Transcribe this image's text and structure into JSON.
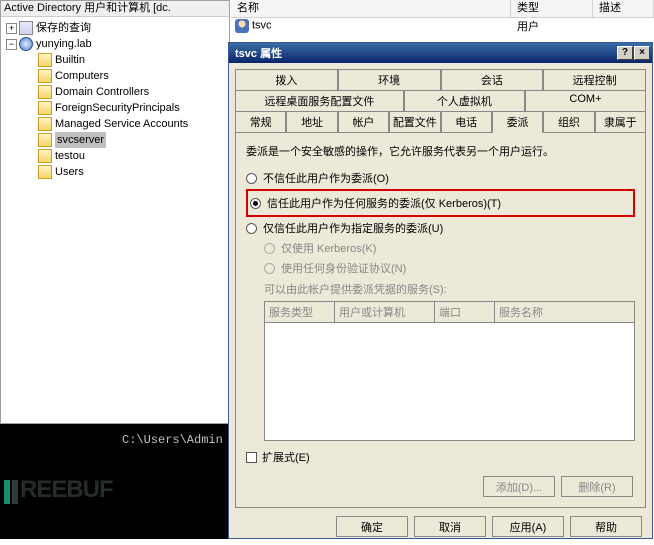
{
  "ad": {
    "title": "Active Directory 用户和计算机 [dc.",
    "saved_queries": "保存的查询",
    "domain": "yunying.lab",
    "nodes": [
      "Builtin",
      "Computers",
      "Domain Controllers",
      "ForeignSecurityPrincipals",
      "Managed Service Accounts",
      "svcserver",
      "testou",
      "Users"
    ],
    "selected": "svcserver"
  },
  "list": {
    "cols": {
      "name": "名称",
      "type": "类型",
      "desc": "描述"
    },
    "row": {
      "icon": "user-icon",
      "name": "tsvc",
      "type": "用户"
    }
  },
  "console": "C:\\Users\\Admin",
  "dialog": {
    "title": "tsvc 属性",
    "tabs_row1": [
      "拨入",
      "环境",
      "会话",
      "远程控制"
    ],
    "tabs_row2": [
      "远程桌面服务配置文件",
      "个人虚拟机",
      "COM+"
    ],
    "tabs_row3": [
      "常规",
      "地址",
      "帐户",
      "配置文件",
      "电话",
      "委派",
      "组织",
      "隶属于"
    ],
    "active_tab": "委派",
    "desc": "委派是一个安全敏感的操作，它允许服务代表另一个用户运行。",
    "radio1": "不信任此用户作为委派(O)",
    "radio2": "信任此用户作为任何服务的委派(仅 Kerberos)(T)",
    "radio3": "仅信任此用户作为指定服务的委派(U)",
    "sub_radio1": "仅使用 Kerberos(K)",
    "sub_radio2": "使用任何身份验证协议(N)",
    "sub_label": "可以由此帐户提供委派凭据的服务(S):",
    "table_cols": [
      "服务类型",
      "用户或计算机",
      "端口",
      "服务名称"
    ],
    "checkbox": "扩展式(E)",
    "btn_add": "添加(D)...",
    "btn_remove": "删除(R)",
    "btn_ok": "确定",
    "btn_cancel": "取消",
    "btn_apply": "应用(A)",
    "btn_help": "帮助"
  }
}
